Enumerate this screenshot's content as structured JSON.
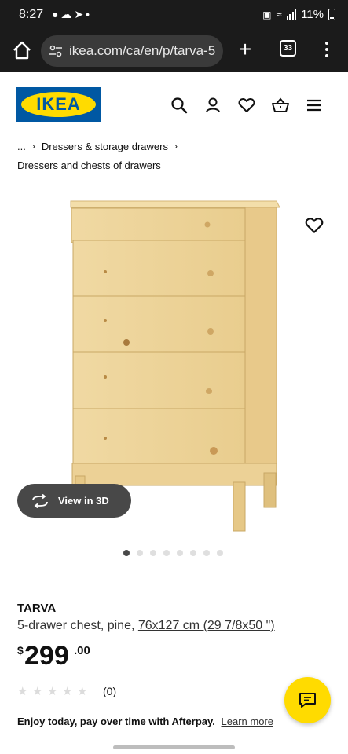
{
  "status_bar": {
    "time": "8:27",
    "battery": "11%"
  },
  "browser": {
    "url": "ikea.com/ca/en/p/tarva-5",
    "tab_count": "33"
  },
  "header": {
    "logo_text": "IKEA",
    "brand_colors": {
      "blue": "#0058a3",
      "yellow": "#ffdb00"
    }
  },
  "breadcrumb": {
    "ellipsis": "...",
    "item1": "Dressers & storage drawers",
    "item2": "Dressers and chests of drawers"
  },
  "gallery": {
    "view_3d_label": "View in 3D",
    "image_count": 8,
    "active_index": 0
  },
  "product": {
    "name": "TARVA",
    "description": "5-drawer chest, pine,",
    "dimensions": "76x127 cm (29 7/8x50 \")",
    "price_currency": "$",
    "price_integer": "299",
    "price_decimal": ".00",
    "rating_count": "(0)",
    "rating_stars": 0
  },
  "afterpay": {
    "text": "Enjoy today, pay over time with Afterpay.",
    "link": "Learn more"
  }
}
